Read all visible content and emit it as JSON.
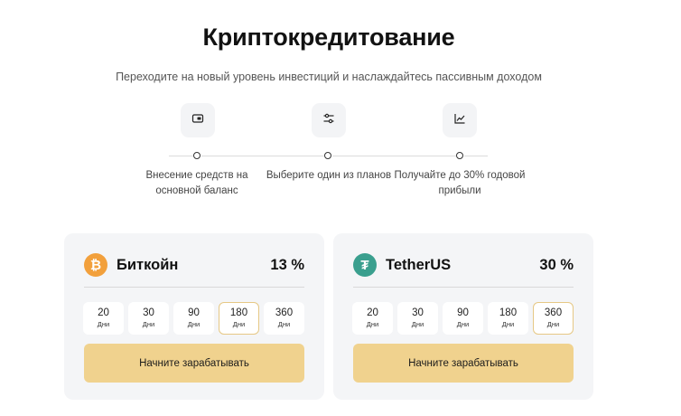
{
  "header": {
    "title": "Криптокредитование",
    "subtitle": "Переходите на новый уровень инвестиций и наслаждайтесь пассивным доходом"
  },
  "steps": [
    {
      "icon": "wallet-icon",
      "text_line1": "Внесение средств на",
      "text_line2": "основной баланс"
    },
    {
      "icon": "sliders-icon",
      "text_line1": "Выберите один из планов",
      "text_line2": ""
    },
    {
      "icon": "chart-icon",
      "text_line1": "Получайте до 30% годовой",
      "text_line2": "прибыли"
    }
  ],
  "plans": [
    {
      "coin": "Биткойн",
      "icon": "bitcoin-icon",
      "symbol": "₿",
      "rate": "13 %",
      "terms": [
        {
          "value": "20",
          "unit": "Дни"
        },
        {
          "value": "30",
          "unit": "Дни"
        },
        {
          "value": "90",
          "unit": "Дни"
        },
        {
          "value": "180",
          "unit": "Дни"
        },
        {
          "value": "360",
          "unit": "Дни"
        }
      ],
      "selected_term": "180",
      "cta": "Начните зарабатывать"
    },
    {
      "coin": "TetherUS",
      "icon": "tether-icon",
      "symbol": "₮",
      "rate": "30 %",
      "terms": [
        {
          "value": "20",
          "unit": "Дни"
        },
        {
          "value": "30",
          "unit": "Дни"
        },
        {
          "value": "90",
          "unit": "Дни"
        },
        {
          "value": "180",
          "unit": "Дни"
        },
        {
          "value": "360",
          "unit": "Дни"
        }
      ],
      "selected_term": "360",
      "cta": "Начните зарабатывать"
    }
  ],
  "colors": {
    "accent": "#f0d28e",
    "selected_border": "#e6c885",
    "bitcoin": "#f2a03c",
    "tether": "#3a9f8e",
    "card_bg": "#f4f5f7"
  }
}
